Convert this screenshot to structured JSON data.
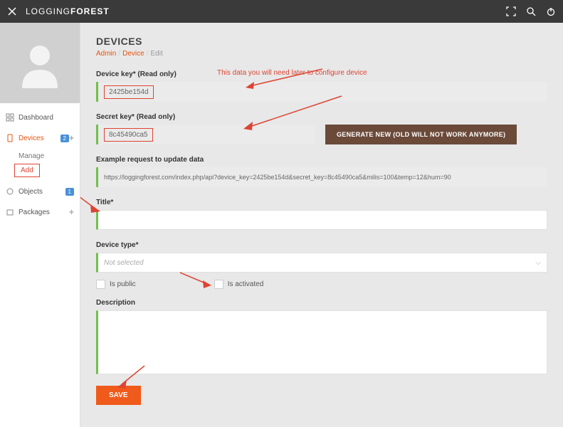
{
  "brand": {
    "part1": "LOGGING",
    "part2": "FOREST"
  },
  "sidebar": {
    "items": [
      {
        "label": "Dashboard"
      },
      {
        "label": "Devices",
        "badge": "2"
      },
      {
        "label": "Objects",
        "badge": "1"
      },
      {
        "label": "Packages"
      }
    ],
    "subitems": {
      "manage": "Manage",
      "add": "Add"
    }
  },
  "page": {
    "title": "DEVICES",
    "breadcrumb": {
      "a": "Admin",
      "b": "Device",
      "c": "Edit"
    }
  },
  "form": {
    "device_key_label": "Device key* (Read only)",
    "device_key_value": "2425be154d",
    "hint": "This data you will need later to configure device",
    "secret_key_label": "Secret key* (Read only)",
    "secret_key_value": "8c45490ca5",
    "generate_btn": "GENERATE NEW (OLD WILL NOT WORK ANYMORE)",
    "example_label": "Example request to update data",
    "example_value": "https://loggingforest.com/index.php/api?device_key=2425be154d&secret_key=8c45490ca5&milis=100&temp=12&hum=90",
    "title_label": "Title*",
    "title_value": "",
    "device_type_label": "Device type*",
    "device_type_value": "Not selected",
    "is_public": "Is public",
    "is_activated": "Is activated",
    "description_label": "Description",
    "description_value": "",
    "save_btn": "SAVE"
  }
}
